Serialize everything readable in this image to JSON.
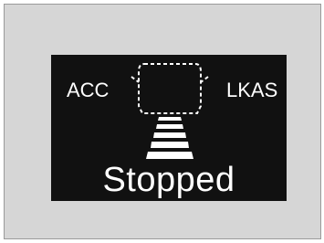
{
  "indicators": {
    "acc_label": "ACC",
    "lkas_label": "LKAS"
  },
  "status": {
    "text": "Stopped"
  },
  "icons": {
    "vehicle_outline": "lead-vehicle-outline-icon",
    "lane_stripes": "lane-stripes-icon"
  },
  "colors": {
    "display_background": "#111111",
    "text": "#ffffff",
    "frame_background": "#d6d6d6"
  }
}
